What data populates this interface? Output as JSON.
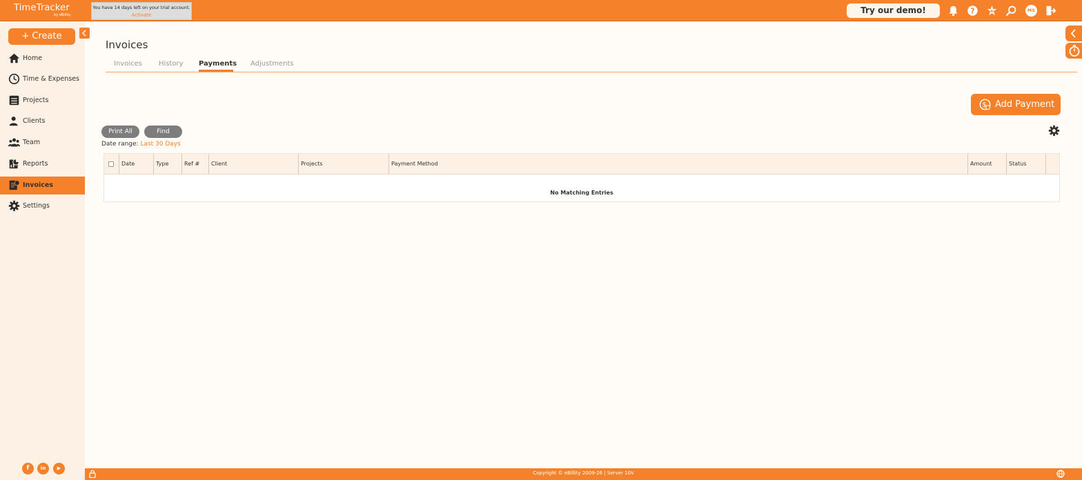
{
  "app": {
    "logo_main": "TimeTracker",
    "logo_sub": "by eBillity"
  },
  "trial": {
    "message": "You have 14 days left on your trial account.",
    "activate": "Activate"
  },
  "topbar": {
    "demo_label": "Try our demo!",
    "avatar_initials": "MS",
    "icons": [
      "bell-icon",
      "help-icon",
      "ai-icon",
      "search-icon",
      "avatar",
      "logout-icon"
    ]
  },
  "sidebar": {
    "create_label": "+ Create",
    "items": [
      {
        "label": "Home",
        "icon": "home-icon",
        "active": false
      },
      {
        "label": "Time & Expenses",
        "icon": "clock-icon",
        "active": false
      },
      {
        "label": "Projects",
        "icon": "projects-icon",
        "active": false
      },
      {
        "label": "Clients",
        "icon": "clients-icon",
        "active": false
      },
      {
        "label": "Team",
        "icon": "team-icon",
        "active": false
      },
      {
        "label": "Reports",
        "icon": "reports-icon",
        "active": false
      },
      {
        "label": "Invoices",
        "icon": "invoices-icon",
        "active": true
      },
      {
        "label": "Settings",
        "icon": "gear-icon",
        "active": false
      }
    ],
    "social": {
      "facebook": "f",
      "linkedin": "in",
      "youtube": "▶"
    }
  },
  "main": {
    "title": "Invoices",
    "tabs": [
      {
        "label": "Invoices",
        "active": false
      },
      {
        "label": "History",
        "active": false
      },
      {
        "label": "Payments",
        "active": true
      },
      {
        "label": "Adjustments",
        "active": false
      }
    ],
    "add_payment_label": "Add Payment",
    "print_all_label": "Print All",
    "find_label": "Find",
    "date_range_label": "Date range:",
    "date_range_value": "Last 30 Days",
    "table": {
      "columns": [
        "Date",
        "Type",
        "Ref #",
        "Client",
        "Projects",
        "Payment Method",
        "Amount",
        "Status"
      ],
      "empty_message": "No Matching Entries"
    }
  },
  "footer": {
    "text": "Copyright © eBillity 2009-26 | Server 10V"
  },
  "colors": {
    "accent": "#f5822a",
    "sidebar_bg": "#fdf1e6",
    "page_bg": "#fffcf8",
    "pill_bg": "#7d7d7d"
  }
}
